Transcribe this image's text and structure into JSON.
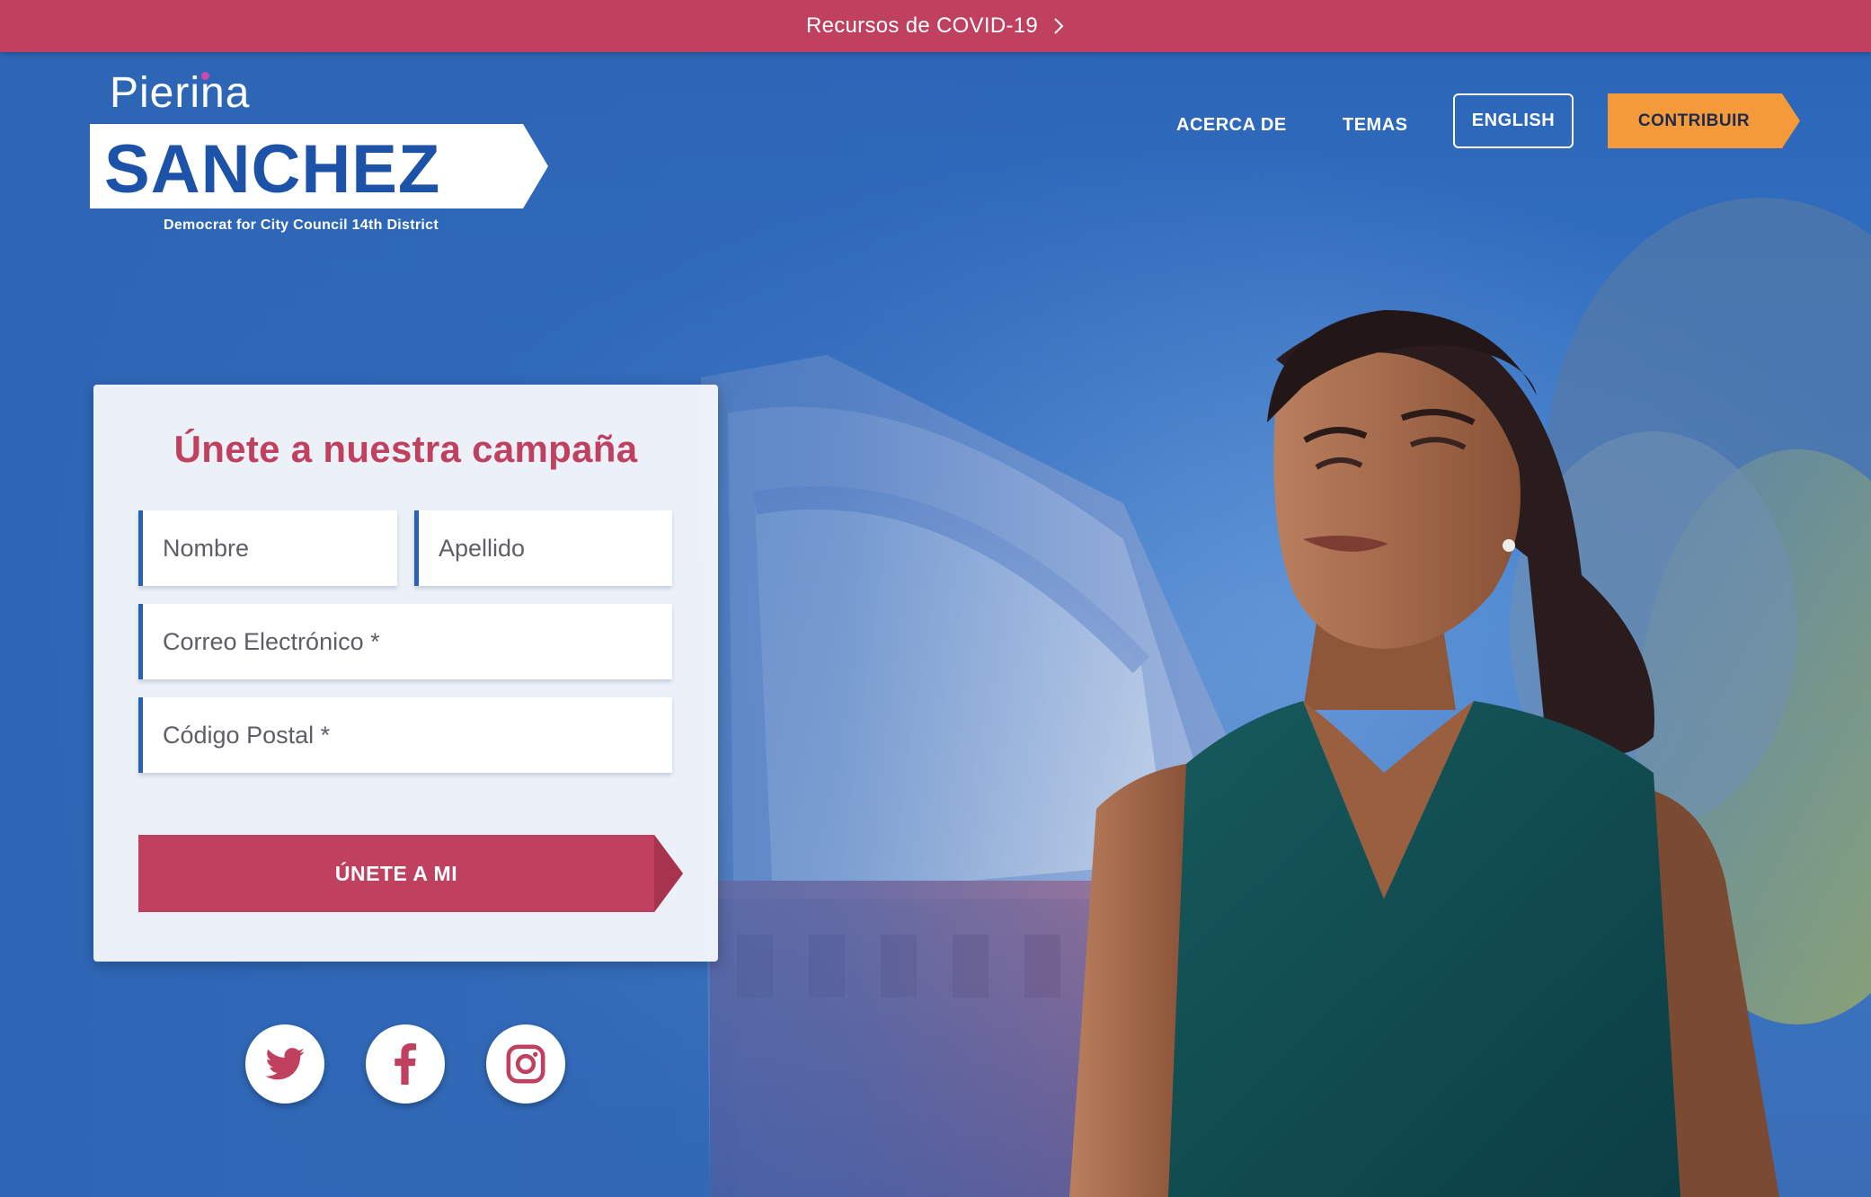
{
  "banner": {
    "text": "Recursos de COVID-19"
  },
  "logo": {
    "first_name": "Pierina",
    "last_name": "SANCHEZ",
    "tagline": "Democrat for City Council 14th District"
  },
  "nav": {
    "about": "ACERCA DE",
    "topics": "TEMAS",
    "language": "ENGLISH",
    "contribute": "CONTRIBUIR"
  },
  "form": {
    "title": "Únete a nuestra campaña",
    "first_name_placeholder": "Nombre",
    "last_name_placeholder": "Apellido",
    "email_placeholder": "Correo Electrónico *",
    "zip_placeholder": "Código Postal *",
    "submit_label": "ÚNETE A MI"
  },
  "social": {
    "twitter_icon": "twitter-icon",
    "facebook_icon": "facebook-icon",
    "instagram_icon": "instagram-icon"
  },
  "colors": {
    "banner": "#c0405f",
    "brand_blue": "#1c52a8",
    "accent_red": "#c0405f",
    "contribute_orange": "#f59a3a"
  }
}
